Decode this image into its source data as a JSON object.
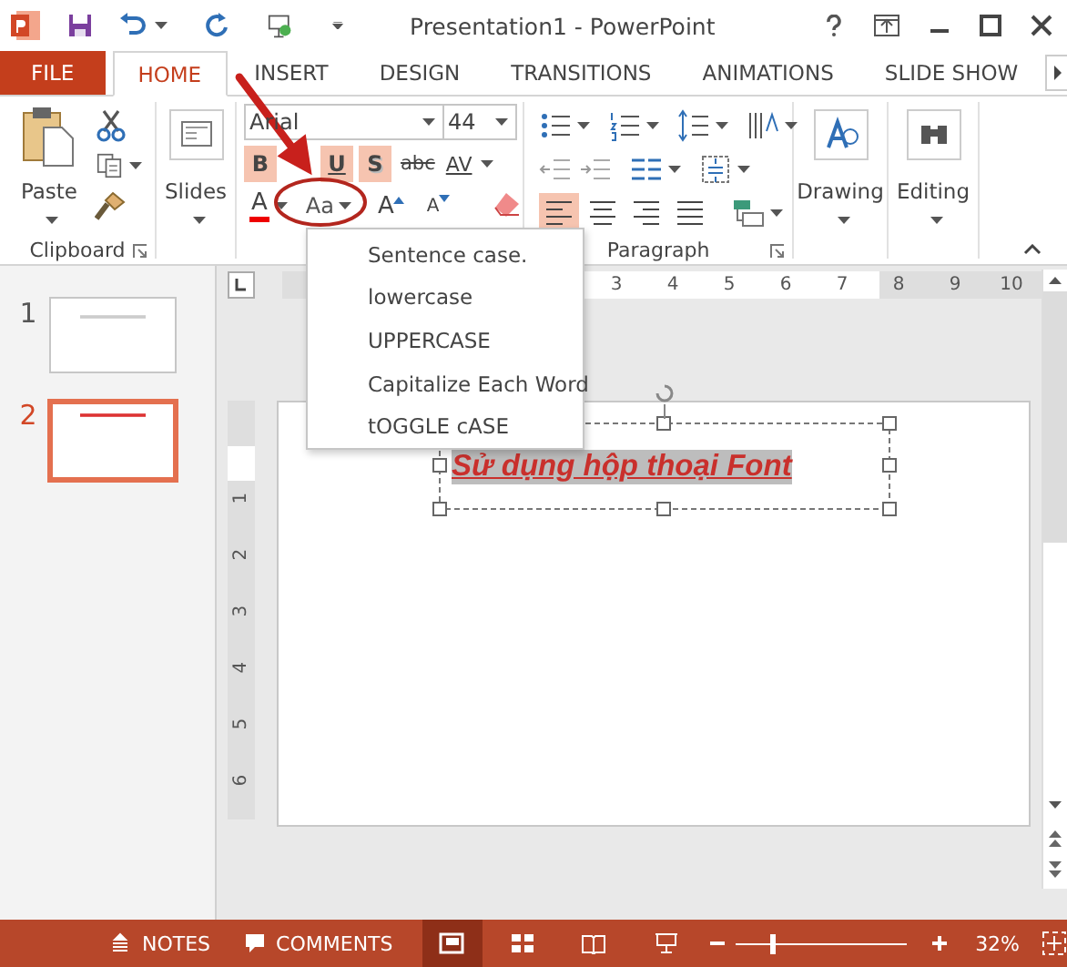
{
  "window": {
    "title": "Presentation1 - PowerPoint"
  },
  "tabs": [
    {
      "label": "FILE",
      "kind": "file",
      "selected": false
    },
    {
      "label": "HOME",
      "kind": "tab",
      "selected": true
    },
    {
      "label": "INSERT",
      "kind": "tab",
      "selected": false
    },
    {
      "label": "DESIGN",
      "kind": "tab",
      "selected": false
    },
    {
      "label": "TRANSITIONS",
      "kind": "tab",
      "selected": false
    },
    {
      "label": "ANIMATIONS",
      "kind": "tab",
      "selected": false
    },
    {
      "label": "SLIDE SHOW",
      "kind": "tab",
      "selected": false
    }
  ],
  "ribbon": {
    "clipboard": {
      "paste": "Paste",
      "label": "Clipboard"
    },
    "slides": {
      "label": "Slides"
    },
    "font": {
      "name": "Arial",
      "size": "44",
      "toggles": [
        {
          "label": "B",
          "kind": "bold",
          "selected": true
        },
        {
          "label": "U",
          "kind": "underline",
          "selected": true
        },
        {
          "label": "S",
          "kind": "shadow",
          "selected": true
        },
        {
          "label": "abc",
          "kind": "strike",
          "selected": false
        },
        {
          "label": "AV",
          "kind": "spacing",
          "selected": false
        }
      ],
      "font_color": "A",
      "change_case": "Aa",
      "grow": "A",
      "shrink": "A"
    },
    "paragraph": {
      "label": "Paragraph",
      "align": [
        {
          "kind": "left",
          "selected": true
        },
        {
          "kind": "center",
          "selected": false
        },
        {
          "kind": "right",
          "selected": false
        },
        {
          "kind": "justify",
          "selected": false
        }
      ]
    },
    "drawing": {
      "label": "Drawing"
    },
    "editing": {
      "label": "Editing"
    }
  },
  "change_case_menu": [
    {
      "label": "Sentence case."
    },
    {
      "label": "lowercase"
    },
    {
      "label": "UPPERCASE"
    },
    {
      "label": "Capitalize Each Word"
    },
    {
      "label": "tOGGLE cASE"
    }
  ],
  "slide_panel": [
    {
      "number": "1",
      "selected": false
    },
    {
      "number": "2",
      "selected": true
    }
  ],
  "ruler": {
    "horizontal": [
      "3",
      "4",
      "5",
      "6",
      "7",
      "8",
      "9",
      "10"
    ],
    "vertical": [
      "1",
      "2",
      "3",
      "4",
      "5",
      "6"
    ]
  },
  "slide": {
    "title": "Sử dụng hộp thoại Font"
  },
  "status_bar": {
    "notes": "NOTES",
    "comments": "COMMENTS",
    "views": [
      {
        "kind": "normal",
        "selected": true
      },
      {
        "kind": "sorter",
        "selected": false
      },
      {
        "kind": "reading",
        "selected": false
      },
      {
        "kind": "slideshow",
        "selected": false
      }
    ],
    "zoom": {
      "level": 0.2,
      "reading": "32%"
    }
  }
}
